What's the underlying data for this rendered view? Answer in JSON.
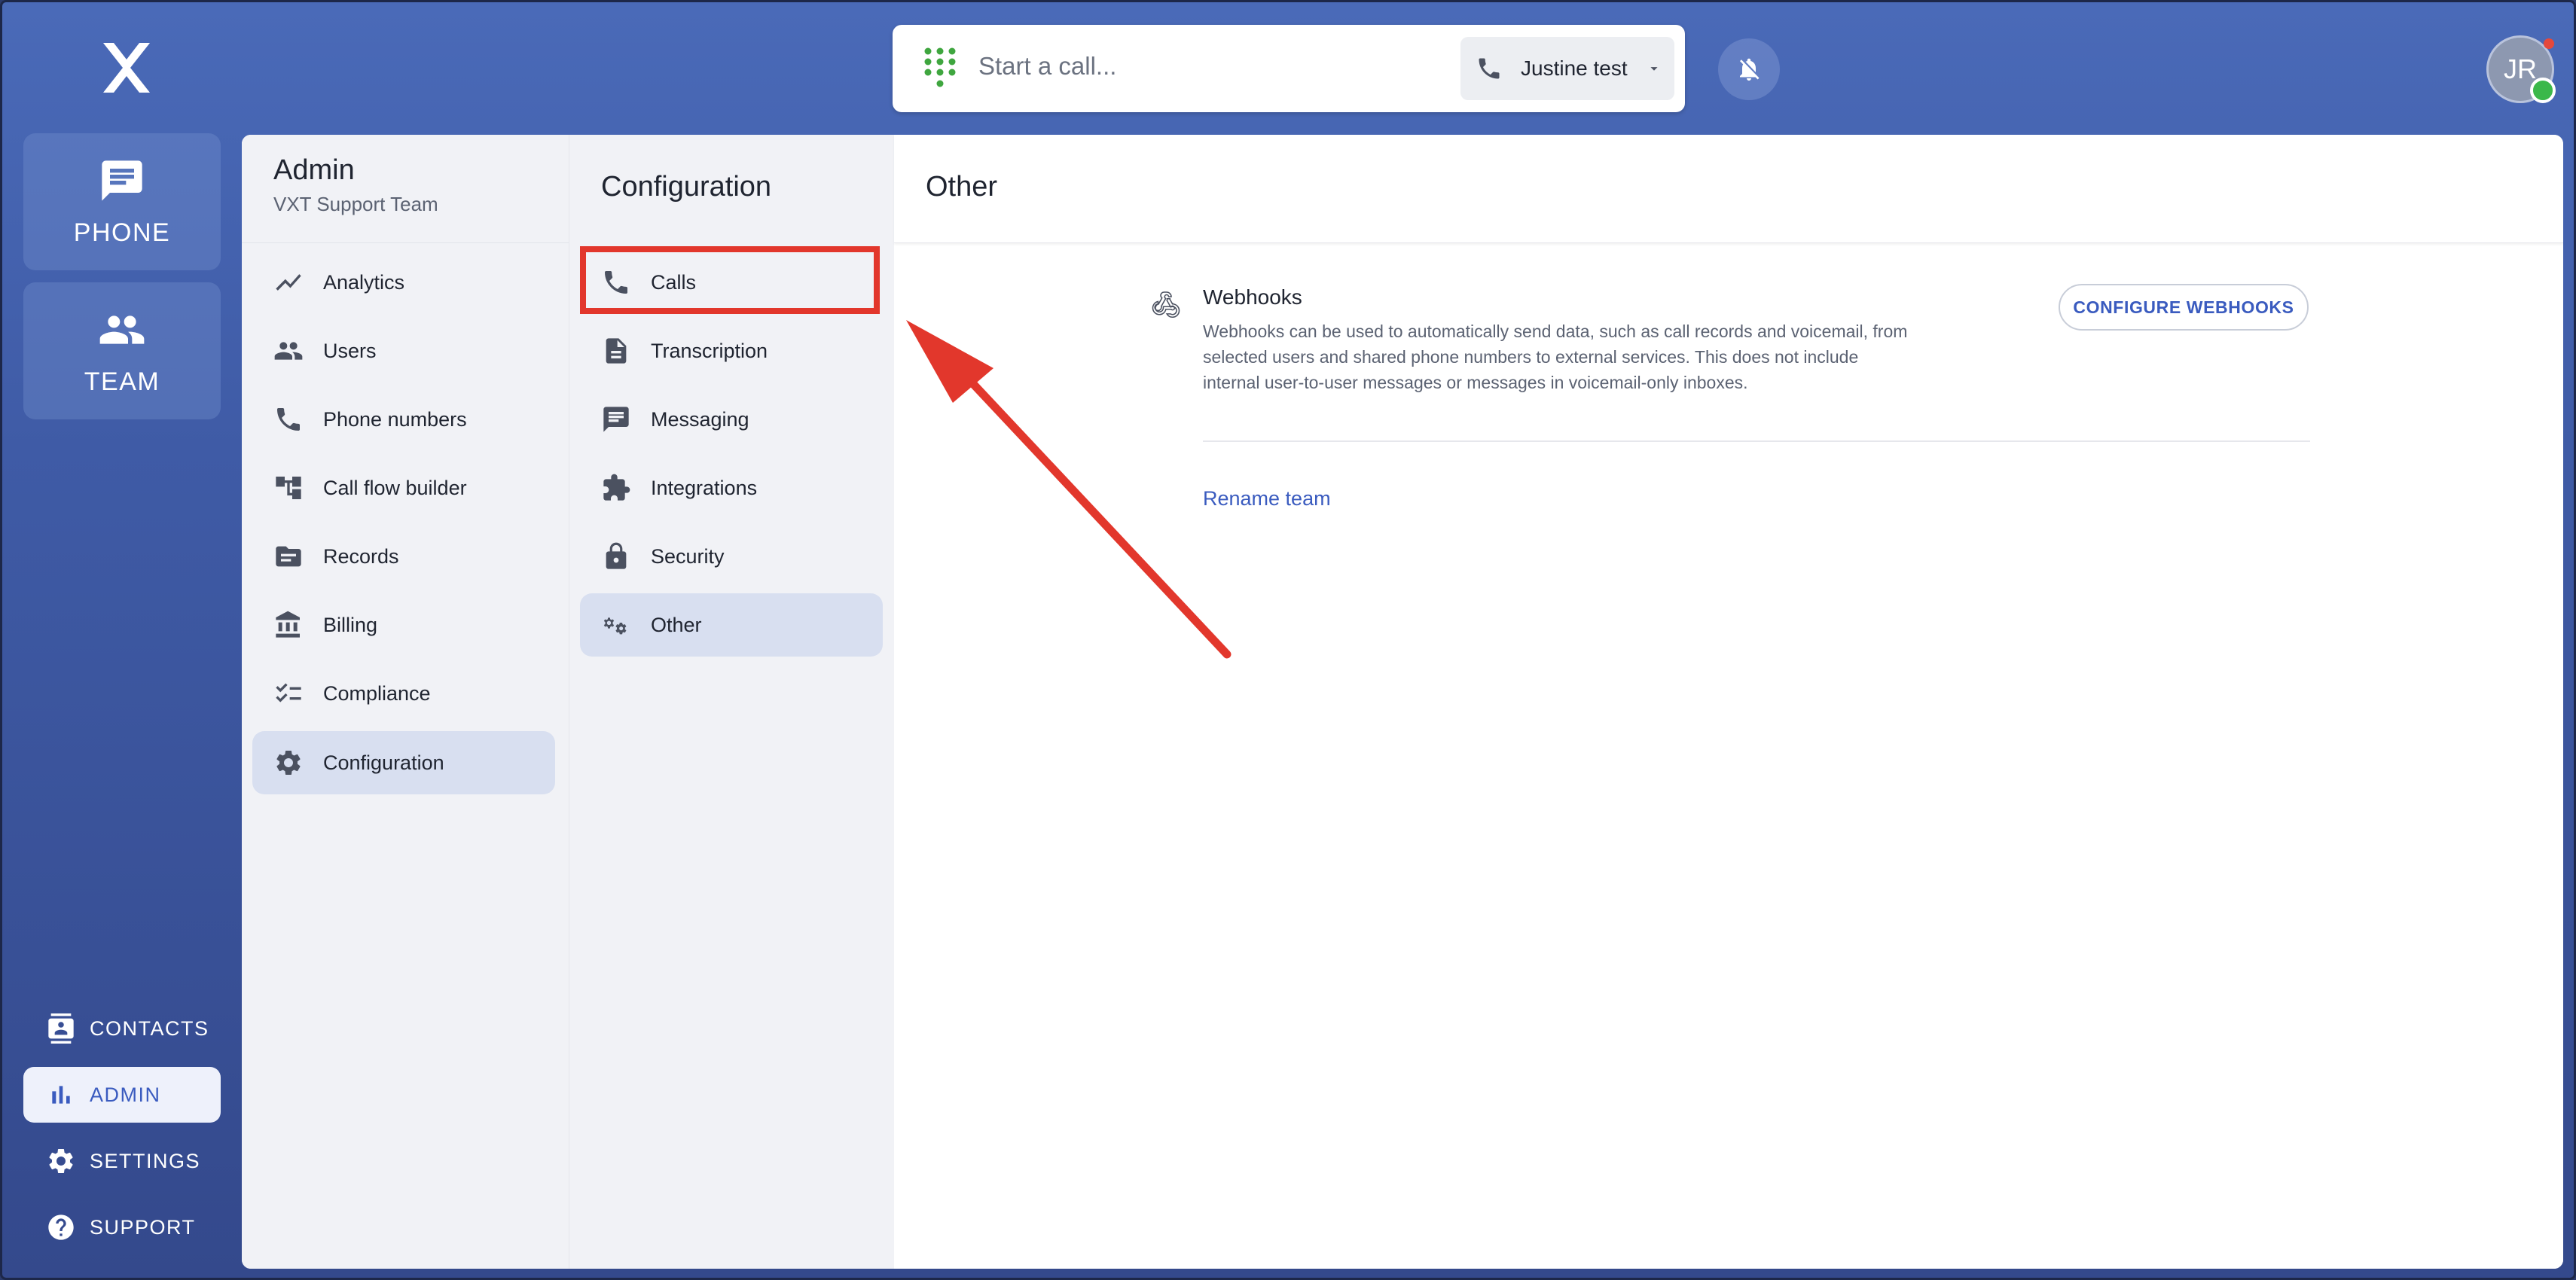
{
  "top": {
    "call_placeholder": "Start a call...",
    "caller_id": "Justine test",
    "avatar_initials": "JR"
  },
  "rail": {
    "phone_label": "PHONE",
    "team_label": "TEAM",
    "bottom": [
      {
        "label": "CONTACTS",
        "icon": "contacts-icon"
      },
      {
        "label": "ADMIN",
        "icon": "bar-chart-icon",
        "active": true
      },
      {
        "label": "SETTINGS",
        "icon": "gear-icon"
      },
      {
        "label": "SUPPORT",
        "icon": "help-icon"
      }
    ]
  },
  "admin": {
    "title": "Admin",
    "subtitle": "VXT Support Team",
    "items": [
      {
        "label": "Analytics",
        "icon": "trend-icon"
      },
      {
        "label": "Users",
        "icon": "users-icon"
      },
      {
        "label": "Phone numbers",
        "icon": "phone-icon"
      },
      {
        "label": "Call flow builder",
        "icon": "flow-icon"
      },
      {
        "label": "Records",
        "icon": "folder-icon"
      },
      {
        "label": "Billing",
        "icon": "bank-icon"
      },
      {
        "label": "Compliance",
        "icon": "checklist-icon"
      },
      {
        "label": "Configuration",
        "icon": "gear-icon",
        "active": true
      }
    ]
  },
  "configuration": {
    "title": "Configuration",
    "items": [
      {
        "label": "Calls",
        "icon": "phone-icon",
        "highlighted": true
      },
      {
        "label": "Transcription",
        "icon": "document-icon"
      },
      {
        "label": "Messaging",
        "icon": "message-icon"
      },
      {
        "label": "Integrations",
        "icon": "puzzle-icon"
      },
      {
        "label": "Security",
        "icon": "lock-icon"
      },
      {
        "label": "Other",
        "icon": "gears-icon",
        "active": true
      }
    ]
  },
  "other": {
    "title": "Other",
    "webhooks_title": "Webhooks",
    "webhooks_desc": "Webhooks can be used to automatically send data, such as call records and voicemail, from selected users and shared phone numbers to external services. This does not include internal user-to-user messages or messages in voicemail-only inboxes.",
    "configure_button": "CONFIGURE WEBHOOKS",
    "rename_link": "Rename team"
  },
  "colors": {
    "accent": "#3a5bbf",
    "annotation_red": "#e2372c",
    "online_green": "#3bb84a"
  }
}
